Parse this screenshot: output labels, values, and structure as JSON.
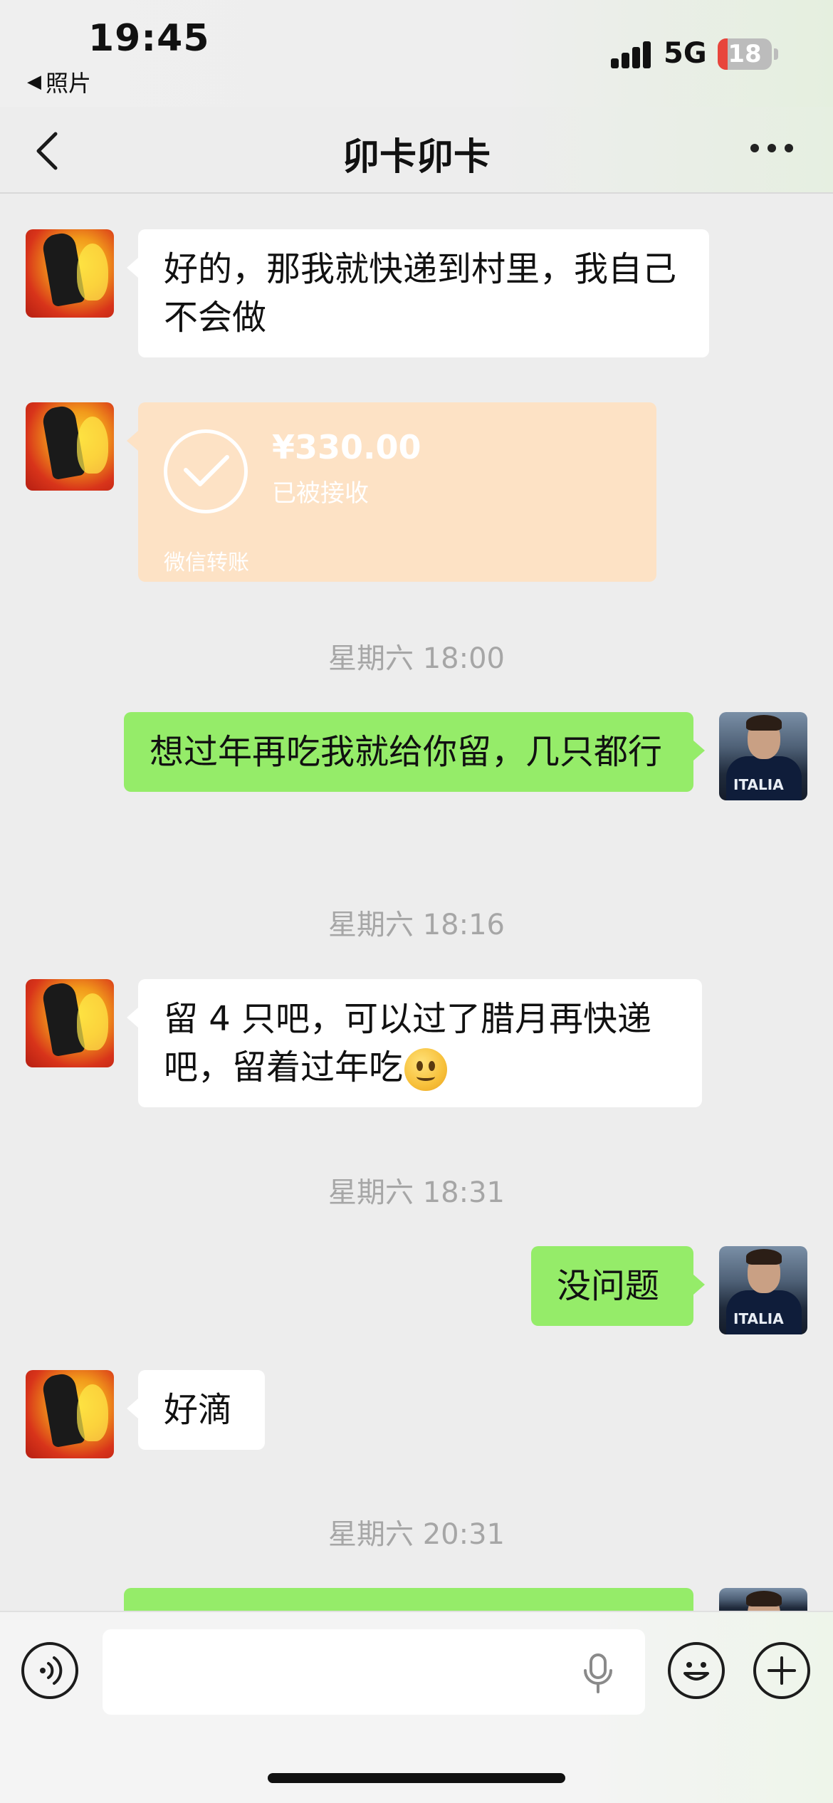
{
  "status_bar": {
    "time": "19:45",
    "back_app": "照片",
    "network": "5G",
    "battery": "18"
  },
  "nav": {
    "title": "卯卡卯卡"
  },
  "messages": [
    {
      "side": "left",
      "text": "好的，那我就快递到村里，我自己不会做"
    },
    {
      "side": "left",
      "type": "transfer",
      "amount": "¥330.00",
      "status": "已被接收",
      "label": "微信转账"
    },
    {
      "type": "timestamp",
      "text": "星期六 18:00"
    },
    {
      "side": "right",
      "text": "想过年再吃我就给你留，几只都行"
    },
    {
      "type": "timestamp",
      "text": "星期六 18:16"
    },
    {
      "side": "left",
      "text": "留 4 只吧，可以过了腊月再快递吧，留着过年吃"
    },
    {
      "type": "timestamp",
      "text": "星期六 18:31"
    },
    {
      "side": "right",
      "text": "没问题"
    },
    {
      "side": "left",
      "text": "好滴"
    },
    {
      "type": "timestamp",
      "text": "星期六 20:31"
    }
  ],
  "input_bar": {
    "placeholder": ""
  },
  "colors": {
    "background": "#ededed",
    "bubble_self": "#95ec69",
    "bubble_other": "#ffffff",
    "transfer_card": "#fde2c5",
    "timestamp": "#a6a6a6"
  },
  "icons": [
    "back-chevron-icon",
    "more-dots-icon",
    "voice-icon",
    "microphone-icon",
    "emoji-icon",
    "plus-icon",
    "checkmark-icon",
    "smile-emoji-icon"
  ]
}
